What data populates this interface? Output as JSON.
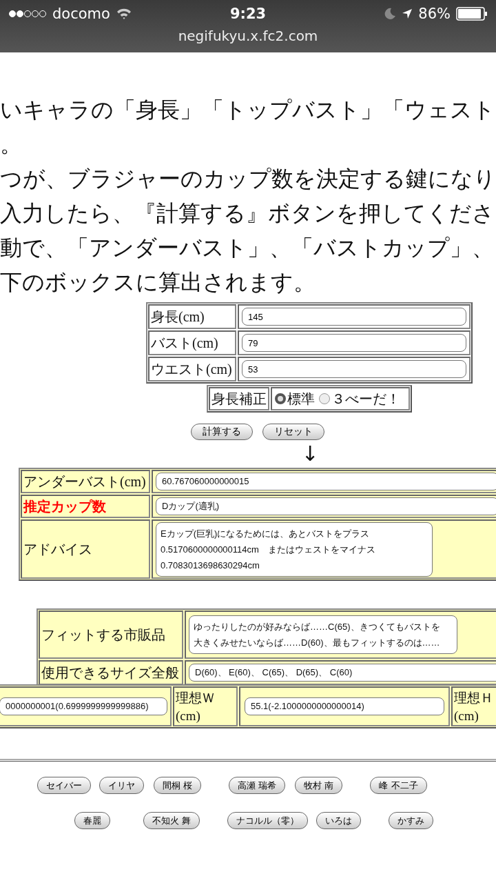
{
  "status_bar": {
    "carrier": "docomo",
    "time": "9:23",
    "battery": "86%",
    "url": "negifukyu.x.fc2.com"
  },
  "intro_lines": [
    "いキャラの「身長」「トップバスト」「ウェスト",
    "。",
    "つが、ブラジャーのカップ数を決定する鍵になり",
    "入力したら、『計算する』ボタンを押してくださ",
    "動で、「アンダーバスト」、「バストカップ」、",
    "下のボックスに算出されます。"
  ],
  "inputs": [
    {
      "label": "身長(cm)",
      "value": "145"
    },
    {
      "label": "バスト(cm)",
      "value": "79"
    },
    {
      "label": "ウエスト(cm)",
      "value": "53"
    }
  ],
  "height_correction": {
    "label": "身長補正",
    "options": [
      {
        "label": "標準",
        "selected": true
      },
      {
        "label": "３べーだ！",
        "selected": false
      }
    ]
  },
  "buttons": [
    "計算する",
    "リセット"
  ],
  "arrow": "↓",
  "results": [
    {
      "label": "アンダーバスト(cm)",
      "value": "60.767060000000015",
      "highlight": false,
      "kind": "field"
    },
    {
      "label": "推定カップ数",
      "value": "Dカップ(適乳)",
      "highlight": true,
      "kind": "field"
    },
    {
      "label": "アドバイス",
      "value": "Eカップ(巨乳)になるためには、あとバストをプラス\n0.5170600000000114cm　またはウェストをマイナス\n0.7083013698630294cm",
      "highlight": false,
      "kind": "box"
    }
  ],
  "fit": [
    {
      "label": "フィットする市販品",
      "lines": [
        "ゆったりしたのが好みならば……C(65)、きつくてもバストを",
        "大きくみせたいならば……D(60)、最もフィットするのは……"
      ],
      "kind": "box"
    },
    {
      "label": "使用できるサイズ全般",
      "value": "D(60)、 E(60)、 C(65)、 D(65)、 C(60)",
      "kind": "field"
    }
  ],
  "ideal": {
    "cut_value": "0000000001(0.6999999999999886)",
    "waist_label": "理想Ｗ",
    "waist_unit": "(cm)",
    "waist_value": "55.1(-2.1000000000000014)",
    "hip_label": "理想Ｈ",
    "hip_unit": "(cm)"
  },
  "characters": [
    [
      "セイバー",
      "イリヤ",
      "間桐 桜",
      "高瀬 瑞希",
      "牧村 南",
      "峰 不二子"
    ],
    [
      "春麗",
      "不知火 舞",
      "ナコルル（零）",
      "いろは",
      "かすみ"
    ]
  ]
}
